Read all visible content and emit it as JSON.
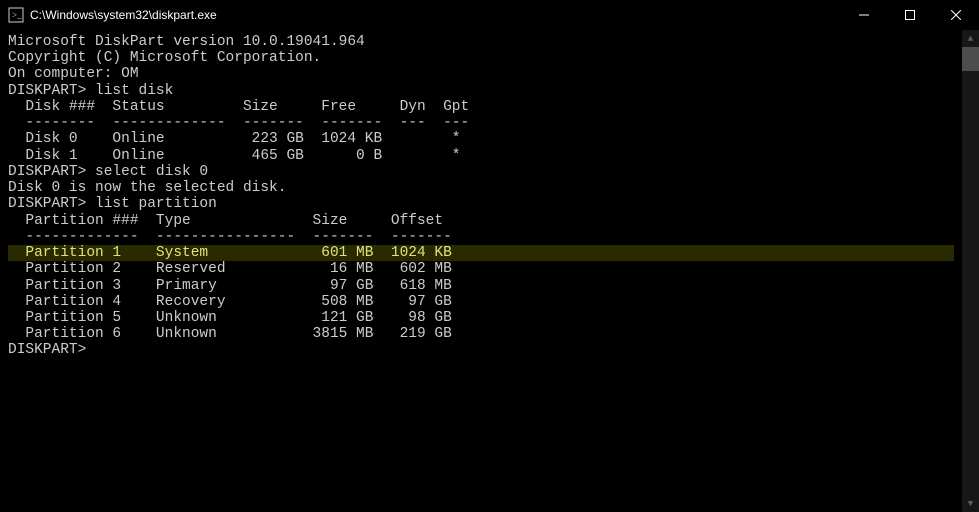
{
  "window": {
    "title": "C:\\Windows\\system32\\diskpart.exe"
  },
  "header": {
    "version_line": "Microsoft DiskPart version 10.0.19041.964",
    "copyright": "Copyright (C) Microsoft Corporation.",
    "computer": "On computer: OM"
  },
  "sessions": [
    {
      "prompt": "DISKPART>",
      "command": "list disk"
    },
    {
      "prompt": "DISKPART>",
      "command": "select disk 0",
      "response": "Disk 0 is now the selected disk."
    },
    {
      "prompt": "DISKPART>",
      "command": "list partition"
    },
    {
      "prompt": "DISKPART>",
      "command": ""
    }
  ],
  "disk_table": {
    "header": "  Disk ###  Status         Size     Free     Dyn  Gpt",
    "divider": "  --------  -------------  -------  -------  ---  ---",
    "rows": [
      "  Disk 0    Online          223 GB  1024 KB        *",
      "  Disk 1    Online          465 GB      0 B        *"
    ]
  },
  "partition_table": {
    "header": "  Partition ###  Type              Size     Offset",
    "divider": "  -------------  ----------------  -------  -------",
    "rows": [
      {
        "text": "  Partition 1    System             601 MB  1024 KB",
        "highlight": true
      },
      {
        "text": "  Partition 2    Reserved            16 MB   602 MB",
        "highlight": false
      },
      {
        "text": "  Partition 3    Primary             97 GB   618 MB",
        "highlight": false
      },
      {
        "text": "  Partition 4    Recovery           508 MB    97 GB",
        "highlight": false
      },
      {
        "text": "  Partition 5    Unknown            121 GB    98 GB",
        "highlight": false
      },
      {
        "text": "  Partition 6    Unknown           3815 MB   219 GB",
        "highlight": false
      }
    ]
  }
}
